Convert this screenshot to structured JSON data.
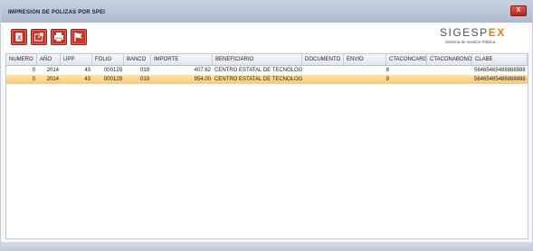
{
  "window": {
    "title": "IMPRESION DE POLIZAS POR SPEI",
    "close_label": "X"
  },
  "toolbar": {
    "buttons": [
      {
        "name": "export-excel-icon"
      },
      {
        "name": "export-share-icon"
      },
      {
        "name": "print-icon"
      },
      {
        "name": "flag-icon"
      }
    ]
  },
  "logo": {
    "main": "SIGESP",
    "accent": "EX",
    "subtitle": "Sistema de Gestión Pública"
  },
  "table": {
    "columns": [
      "NUMERO",
      "AÑO",
      "UPP",
      "FOLIO",
      "BANCO",
      "IMPORTE",
      "BENEFICIARIO",
      "DOCUMENTO",
      "ENVIO",
      "CTACONCARGO",
      "CTACONABONO",
      "CLABE"
    ],
    "rows": [
      {
        "numero": "0",
        "anio": "2014",
        "upp": "43",
        "folio": "000129",
        "banco": "019",
        "importe": "407.62",
        "beneficiario": "CENTRO ESTATAL DE TECNOLOGIA",
        "documento": "",
        "envio": "8",
        "ctaconcargo": "",
        "ctaconabono": "",
        "clabe": "56465465488888888"
      },
      {
        "numero": "0",
        "anio": "2014",
        "upp": "43",
        "folio": "000129",
        "banco": "019",
        "importe": "954.00",
        "beneficiario": "CENTRO ESTATAL DE TECNOLOGIA",
        "documento": "",
        "envio": "9",
        "ctaconcargo": "",
        "ctaconabono": "",
        "clabe": "56465465488888888"
      }
    ],
    "selected_row": 1
  },
  "colors": {
    "selection": "#f7c976",
    "close": "#c8342a",
    "accent": "#e07e22"
  }
}
